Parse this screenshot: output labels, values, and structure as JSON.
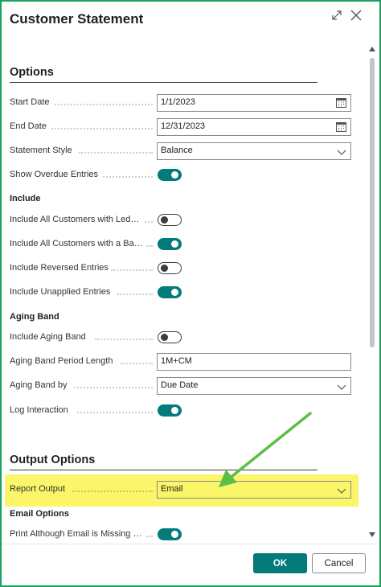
{
  "dialog": {
    "title": "Customer Statement",
    "expand_icon": "expand-icon",
    "close_icon": "close-icon"
  },
  "options": {
    "heading": "Options",
    "start_date": {
      "label": "Start Date",
      "value": "1/1/2023"
    },
    "end_date": {
      "label": "End Date",
      "value": "12/31/2023"
    },
    "statement_style": {
      "label": "Statement Style",
      "value": "Balance"
    },
    "show_overdue": {
      "label": "Show Overdue Entries",
      "on": true
    },
    "include_heading": "Include",
    "include_all_customers_ledger": {
      "label": "Include All Customers with Led…",
      "on": false
    },
    "include_all_customers_balance": {
      "label": "Include All Customers with a Ba…",
      "on": true
    },
    "include_reversed": {
      "label": "Include Reversed Entries",
      "on": false
    },
    "include_unapplied": {
      "label": "Include Unapplied Entries",
      "on": true
    },
    "aging_heading": "Aging Band",
    "include_aging_band": {
      "label": "Include Aging Band",
      "on": false
    },
    "aging_period_length": {
      "label": "Aging Band Period Length",
      "value": "1M+CM"
    },
    "aging_band_by": {
      "label": "Aging Band by",
      "value": "Due Date"
    },
    "log_interaction": {
      "label": "Log Interaction",
      "on": true
    }
  },
  "output": {
    "heading": "Output Options",
    "report_output": {
      "label": "Report Output",
      "value": "Email"
    },
    "email_heading": "Email Options",
    "print_although_missing": {
      "label": "Print Although Email is Missing …",
      "on": true
    }
  },
  "footer": {
    "ok_label": "OK",
    "cancel_label": "Cancel"
  },
  "colors": {
    "accent": "#047b7b",
    "frame": "#1aa260",
    "highlight": "#fbf56a",
    "arrow": "#5bbf45"
  }
}
